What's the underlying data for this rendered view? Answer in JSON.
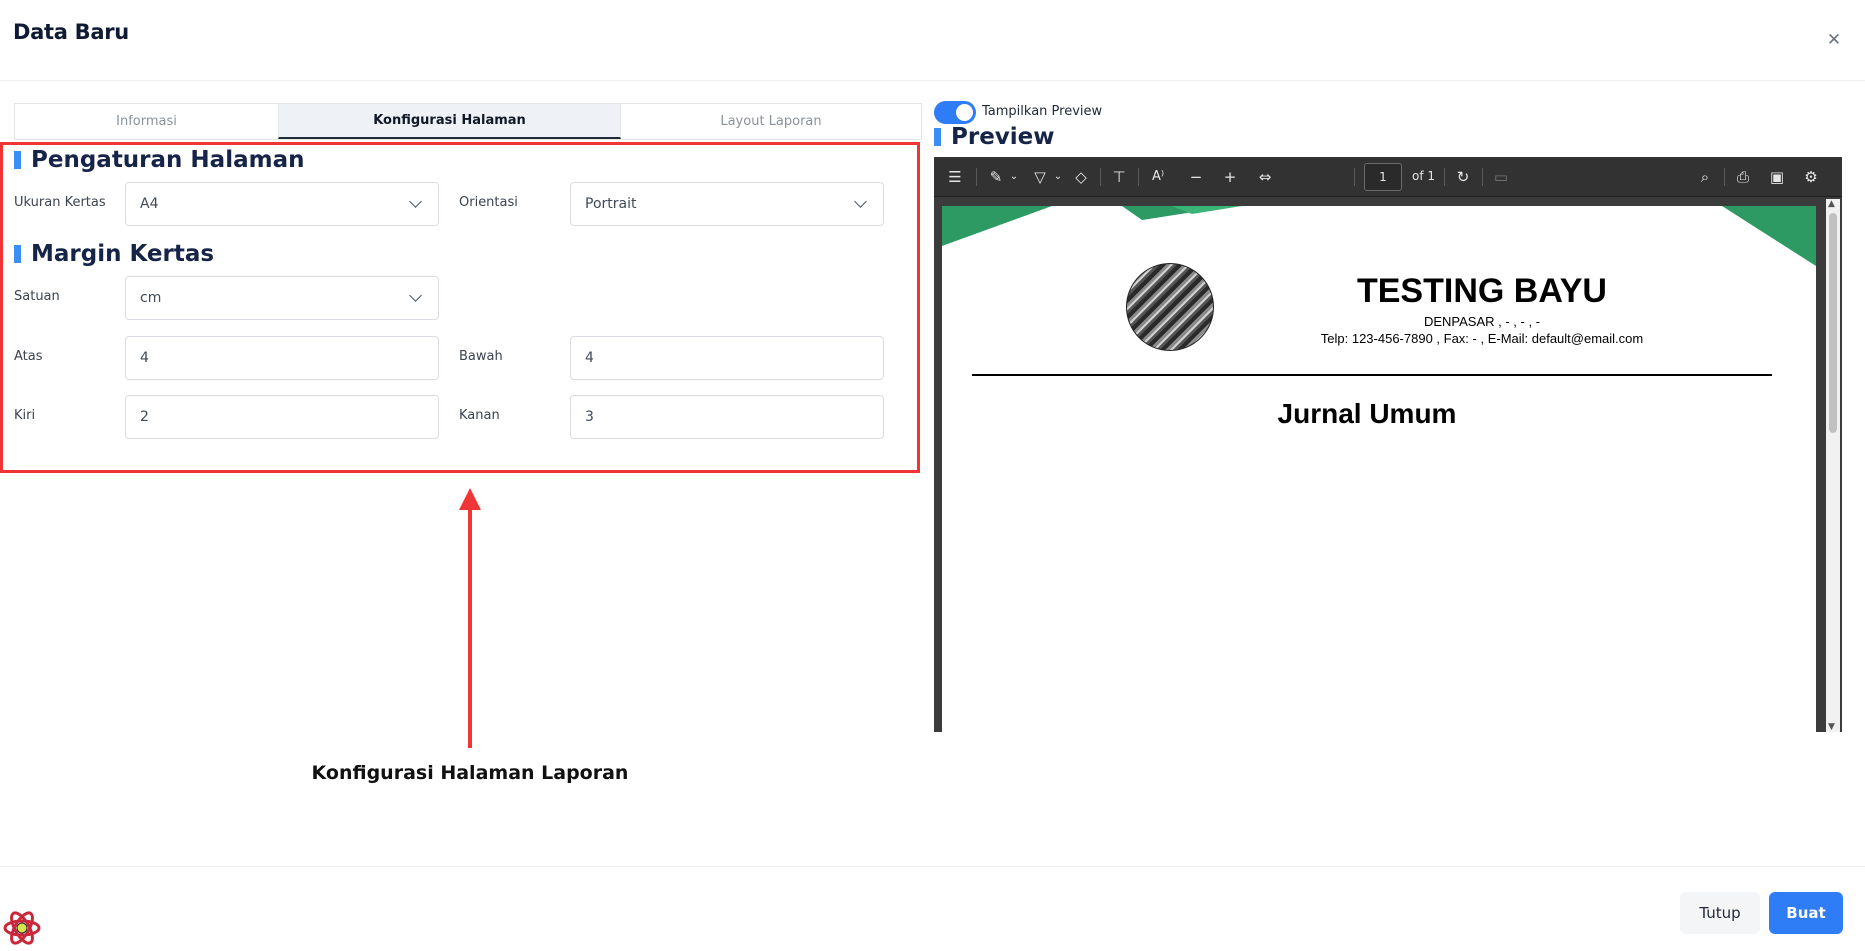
{
  "modal": {
    "title": "Data Baru"
  },
  "tabs": [
    {
      "label": "Informasi",
      "active": false
    },
    {
      "label": "Konfigurasi Halaman",
      "active": true
    },
    {
      "label": "Layout Laporan",
      "active": false
    }
  ],
  "page_settings": {
    "heading": "Pengaturan Halaman",
    "paper_size": {
      "label": "Ukuran Kertas",
      "value": "A4"
    },
    "orientation": {
      "label": "Orientasi",
      "value": "Portrait"
    }
  },
  "margin_settings": {
    "heading": "Margin Kertas",
    "unit": {
      "label": "Satuan",
      "value": "cm"
    },
    "top": {
      "label": "Atas",
      "value": "4"
    },
    "bottom": {
      "label": "Bawah",
      "value": "4"
    },
    "left": {
      "label": "Kiri",
      "value": "2"
    },
    "right": {
      "label": "Kanan",
      "value": "3"
    }
  },
  "annotation": {
    "text": "Konfigurasi Halaman Laporan"
  },
  "preview": {
    "toggle_label": "Tampilkan Preview",
    "toggle_on": true,
    "heading": "Preview",
    "toolbar": {
      "page_number": "1",
      "page_of": "of 1"
    },
    "document": {
      "company": "TESTING BAYU",
      "address": "DENPASAR , - , - , -",
      "contact": "Telp:   123-456-7890  , Fax:   -  , E-Mail:   default@email.com",
      "report_title": "Jurnal Umum"
    }
  },
  "footer": {
    "close_label": "Tutup",
    "create_label": "Buat"
  },
  "colors": {
    "accent": "#2f7df6",
    "highlight": "#ef3535",
    "heading": "#152447",
    "doc_green": "#2e9a63"
  }
}
